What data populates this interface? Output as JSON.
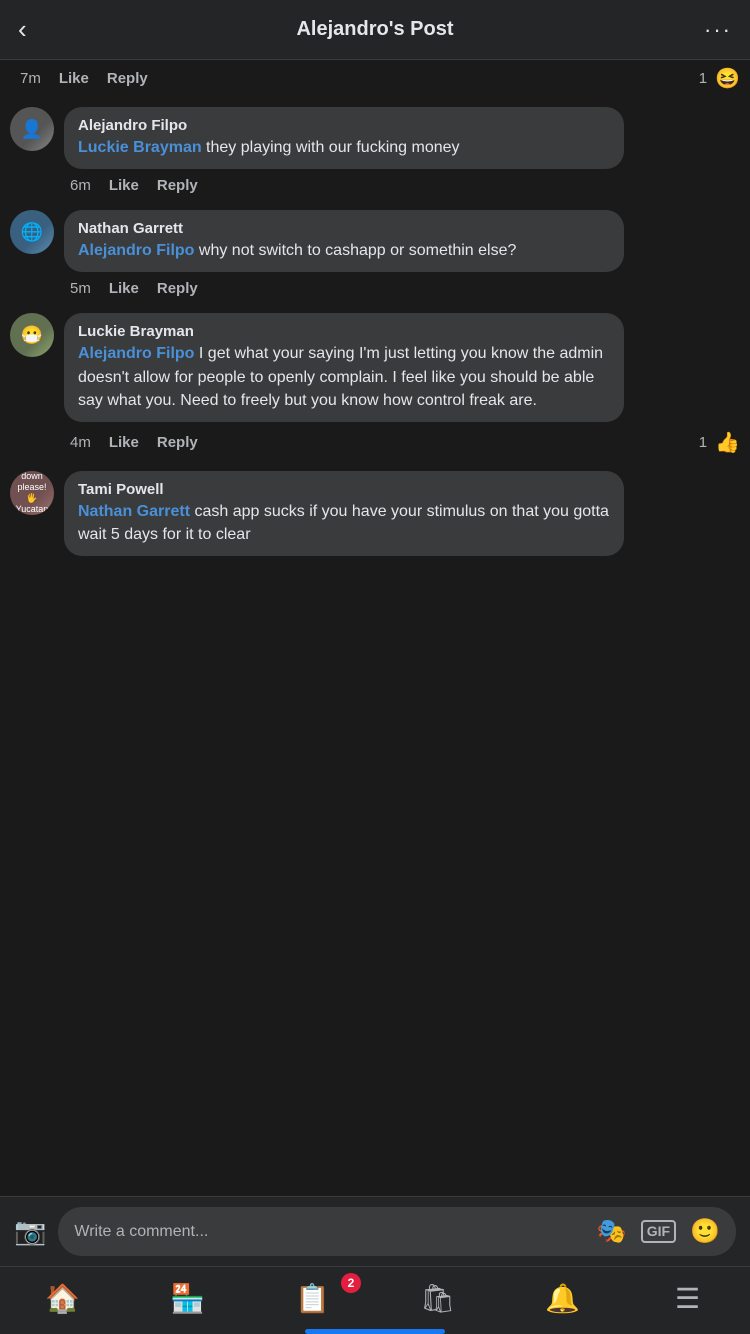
{
  "header": {
    "title": "Alejandro's Post",
    "back_label": "‹",
    "more_label": "···"
  },
  "comments": [
    {
      "id": "comment-1-action",
      "type": "action-row",
      "time": "7m",
      "like": "Like",
      "reply": "Reply",
      "reaction_count": "1",
      "reaction_emoji": "😆",
      "indent": false
    },
    {
      "id": "comment-2",
      "type": "comment",
      "author": "Alejandro Filpo",
      "mention": "Luckie Brayman",
      "text": " they playing with our fucking money",
      "time": "6m",
      "like": "Like",
      "reply": "Reply",
      "avatar_label": "👤",
      "indent": false
    },
    {
      "id": "comment-3",
      "type": "comment",
      "author": "Nathan Garrett",
      "mention": "Alejandro Filpo",
      "text": " why not switch to cashapp or somethin else?",
      "time": "5m",
      "like": "Like",
      "reply": "Reply",
      "avatar_label": "🌐",
      "indent": false
    },
    {
      "id": "comment-4",
      "type": "comment",
      "author": "Luckie Brayman",
      "mention": "Alejandro Filpo",
      "text": " I get what your saying I'm just letting you know the admin doesn't allow for people to openly complain.  I feel like you should be able say what you.  Need to freely but you know how control freak are.",
      "time": "4m",
      "like": "Like",
      "reply": "Reply",
      "reaction_count": "1",
      "reaction_emoji": "👍",
      "avatar_label": "😷",
      "indent": false
    },
    {
      "id": "comment-5",
      "type": "comment",
      "author": "Tami Powell",
      "mention": "Nathan Garrett",
      "text": " cash app sucks if you have your stimulus on that you gotta wait 5 days for it to clear",
      "time": "",
      "like": "",
      "reply": "",
      "avatar_label": "Come down please!\n🖐\nYucatan dawn",
      "indent": false,
      "partial": true
    }
  ],
  "input_bar": {
    "placeholder": "Write a comment...",
    "camera_icon": "📷",
    "gif_label": "GIF",
    "sticker_icon": "😊",
    "emoji_icon": "🙂"
  },
  "bottom_nav": {
    "items": [
      {
        "id": "home",
        "icon": "🏠",
        "active": true,
        "badge": null
      },
      {
        "id": "store",
        "icon": "🏪",
        "active": false,
        "badge": null
      },
      {
        "id": "news",
        "icon": "📋",
        "active": false,
        "badge": "2"
      },
      {
        "id": "marketplace",
        "icon": "🛍",
        "active": false,
        "badge": null
      },
      {
        "id": "bell",
        "icon": "🔔",
        "active": false,
        "badge": null
      },
      {
        "id": "menu",
        "icon": "☰",
        "active": false,
        "badge": null
      }
    ]
  }
}
